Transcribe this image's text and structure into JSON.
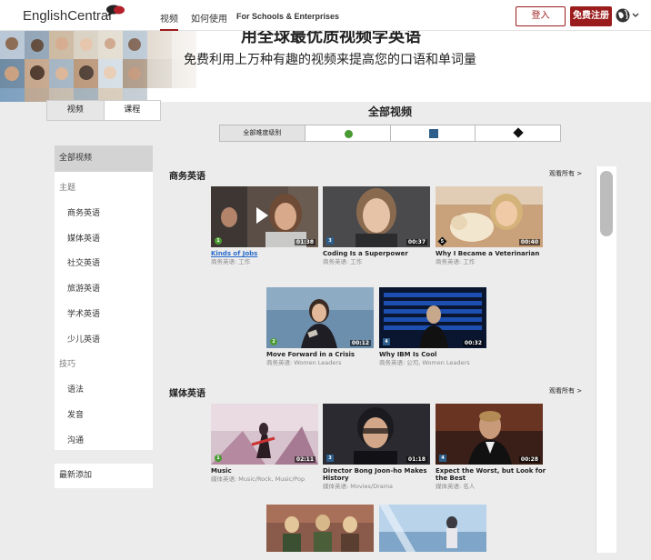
{
  "header": {
    "logo": "EnglishCentral",
    "nav": [
      "视频",
      "如何使用",
      "For Schools & Enterprises"
    ],
    "login": "登入",
    "signup": "免费注册"
  },
  "hero": {
    "title": "用全球最优质视频学英语",
    "subtitle": "免费利用上万种有趣的视频来提高您的口语和单词量"
  },
  "toggle": {
    "videos": "视频",
    "courses": "课程"
  },
  "sidebar": {
    "all": "全部视频",
    "topics_heading": "主题",
    "topics": [
      "商务英语",
      "媒体英语",
      "社交英语",
      "旅游英语",
      "学术英语",
      "少儿英语"
    ],
    "skills_heading": "技巧",
    "skills": [
      "语法",
      "发音",
      "沟通"
    ],
    "recent": "最新添加"
  },
  "main": {
    "title": "全部视频",
    "levels_all": "全部难度级别",
    "level_colors": {
      "beginner": "#4a9a33",
      "intermediate": "#2b5e8a",
      "advanced": "#111111"
    }
  },
  "sections": [
    {
      "title": "商务英语",
      "see_all": "观看所有 >",
      "videos": [
        {
          "title": "Kinds of Jobs",
          "meta": "商务英语: 工作",
          "duration": "01:38",
          "level": "1"
        },
        {
          "title": "Coding Is a Superpower",
          "meta": "商务英语: 工作",
          "duration": "00:37",
          "level": "3"
        },
        {
          "title": "Why I Became a Veterinarian",
          "meta": "商务英语: 工作",
          "duration": "00:40",
          "level": "5"
        },
        {
          "title": "Move Forward in a Crisis",
          "meta": "商务英语: Women Leaders",
          "duration": "00:12",
          "level": "2"
        },
        {
          "title": "Why IBM Is Cool",
          "meta": "商务英语: 公司, Women Leaders",
          "duration": "00:32",
          "level": "4"
        }
      ]
    },
    {
      "title": "媒体英语",
      "see_all": "观看所有 >",
      "videos": [
        {
          "title": "Music",
          "meta": "媒体英语: Music/Rock, Music/Pop",
          "duration": "02:11",
          "level": "1"
        },
        {
          "title": "Director Bong Joon-ho Makes History",
          "meta": "媒体英语: Movies/Drama",
          "duration": "01:18",
          "level": "3"
        },
        {
          "title": "Expect the Worst, but Look for the Best",
          "meta": "媒体英语: 名人",
          "duration": "00:28",
          "level": "4"
        }
      ]
    }
  ]
}
